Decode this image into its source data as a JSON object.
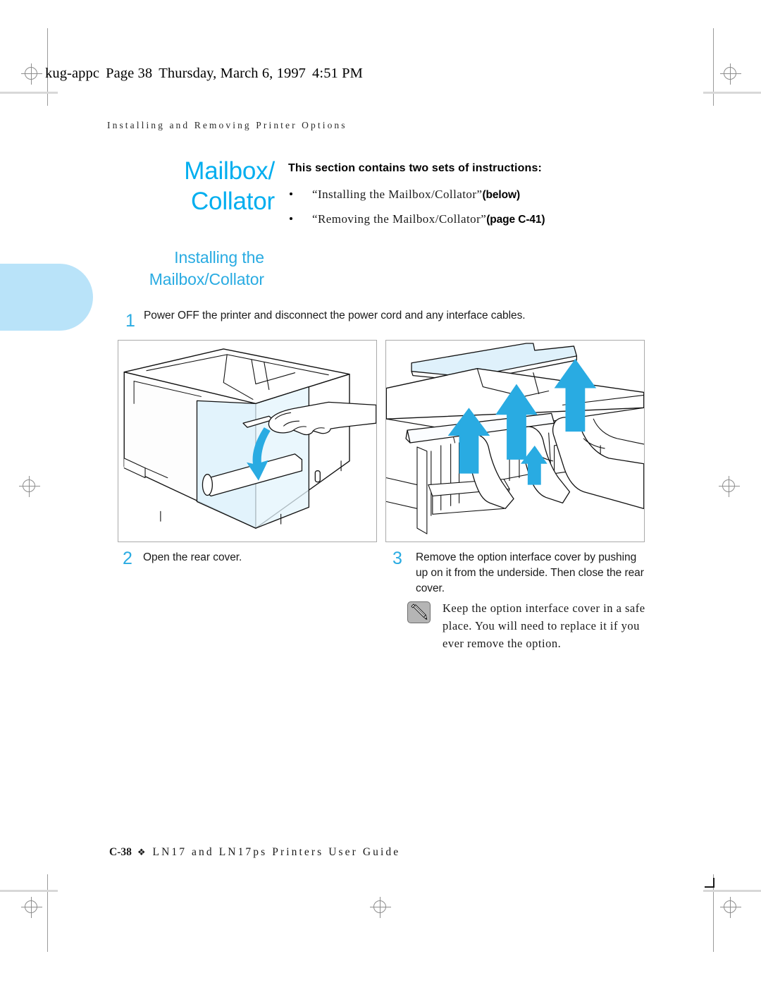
{
  "header": {
    "file": "kug-appc",
    "page_label": "Page 38",
    "date": "Thursday, March 6, 1997",
    "time": "4:51 PM"
  },
  "running_head": "Installing and Removing Printer Options",
  "chapter_title": "Mailbox/ Collator",
  "intro": {
    "lead": "This section contains two sets of instructions:",
    "bullets": [
      {
        "title": "“Installing the Mailbox/Collator”",
        "ref": "(below)"
      },
      {
        "title": "“Removing the Mailbox/Collator”",
        "ref": "(page C-41)"
      }
    ]
  },
  "section_heading": "Installing the Mailbox/Collator",
  "steps": [
    {
      "number": "1",
      "text": "Power OFF the printer and disconnect the power cord and any interface cables."
    },
    {
      "number": "2",
      "text": "Open the rear cover."
    },
    {
      "number": "3",
      "text": "Remove the option interface cover by pushing up on it from the underside. Then close the rear cover."
    }
  ],
  "note": {
    "icon": "pencil-icon",
    "text": "Keep the option interface cover in a safe place. You will need to replace it if you ever remove the option."
  },
  "footer": {
    "page": "C-38",
    "diamond": "❖",
    "guide": "LN17 and LN17ps Printers User Guide"
  },
  "colors": {
    "accent_cyan": "#00aeef",
    "heading_cyan": "#29abe2",
    "tab_blue": "#b9e3f9",
    "arrow_blue": "#29abe2",
    "panel_tint": "#d9f0fb"
  }
}
